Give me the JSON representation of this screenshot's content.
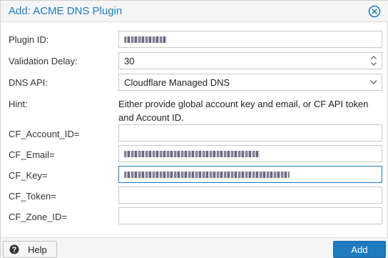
{
  "dialog": {
    "title": "Add: ACME DNS Plugin",
    "close_icon": "close-circle-icon"
  },
  "form": {
    "plugin_id": {
      "label": "Plugin ID:",
      "value": ""
    },
    "validation_delay": {
      "label": "Validation Delay:",
      "value": "30"
    },
    "dns_api": {
      "label": "DNS API:",
      "value": "Cloudflare Managed DNS"
    },
    "hint": {
      "label": "Hint:",
      "text": "Either provide global account key and email, or CF API token and Account ID."
    },
    "cf_account_id": {
      "label": "CF_Account_ID=",
      "value": ""
    },
    "cf_email": {
      "label": "CF_Email=",
      "value": ""
    },
    "cf_key": {
      "label": "CF_Key=",
      "value": ""
    },
    "cf_token": {
      "label": "CF_Token=",
      "value": ""
    },
    "cf_zone_id": {
      "label": "CF_Zone_ID=",
      "value": ""
    }
  },
  "footer": {
    "help_label": "Help",
    "help_icon": "help-circle-icon",
    "add_label": "Add"
  },
  "colors": {
    "accent": "#1e7bbd",
    "title": "#1e7bbd"
  }
}
